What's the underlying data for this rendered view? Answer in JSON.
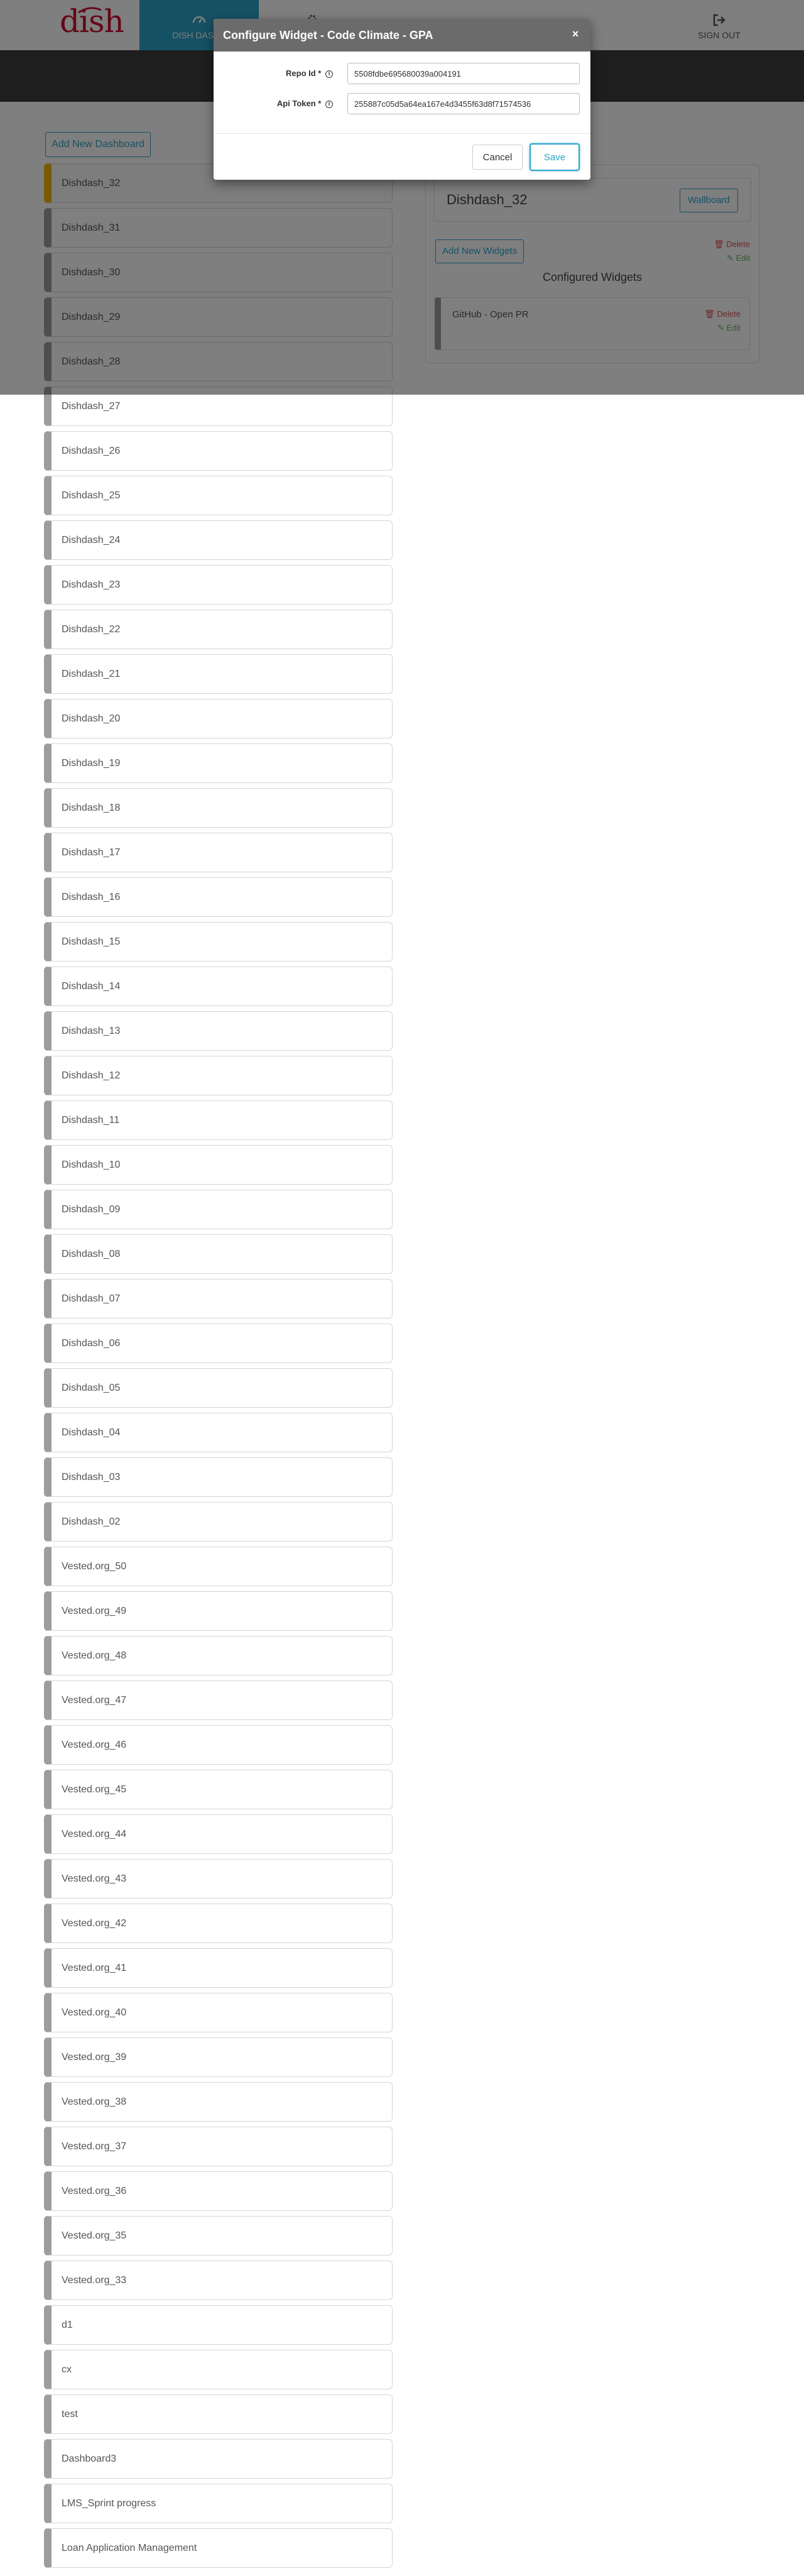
{
  "nav": {
    "logo_text": "dish",
    "dash_label": "DISH DASHB",
    "signout_label": "SIGN OUT"
  },
  "dashboards": {
    "add_label": "Add New Dashboard",
    "active_index": 0,
    "items": [
      "Dishdash_32",
      "Dishdash_31",
      "Dishdash_30",
      "Dishdash_29",
      "Dishdash_28",
      "Dishdash_27",
      "Dishdash_26",
      "Dishdash_25",
      "Dishdash_24",
      "Dishdash_23",
      "Dishdash_22",
      "Dishdash_21",
      "Dishdash_20",
      "Dishdash_19",
      "Dishdash_18",
      "Dishdash_17",
      "Dishdash_16",
      "Dishdash_15",
      "Dishdash_14",
      "Dishdash_13",
      "Dishdash_12",
      "Dishdash_11",
      "Dishdash_10",
      "Dishdash_09",
      "Dishdash_08",
      "Dishdash_07",
      "Dishdash_06",
      "Dishdash_05",
      "Dishdash_04",
      "Dishdash_03",
      "Dishdash_02",
      "Vested.org_50",
      "Vested.org_49",
      "Vested.org_48",
      "Vested.org_47",
      "Vested.org_46",
      "Vested.org_45",
      "Vested.org_44",
      "Vested.org_43",
      "Vested.org_42",
      "Vested.org_41",
      "Vested.org_40",
      "Vested.org_39",
      "Vested.org_38",
      "Vested.org_37",
      "Vested.org_36",
      "Vested.org_35",
      "Vested.org_33",
      "d1",
      "cx",
      "test",
      "Dashboard3",
      "LMS_Sprint progress",
      "Loan Application Management"
    ]
  },
  "panel": {
    "title": "Dishdash_32",
    "wallboard_label": "Wallboard",
    "add_widget_label": "Add New Widgets",
    "delete_label": "Delete",
    "edit_label": "Edit",
    "configured_title": "Configured Widgets",
    "widgets": [
      {
        "name": "GitHub - Open PR",
        "delete_label": "Delete",
        "edit_label": "Edit"
      }
    ]
  },
  "modal": {
    "title": "Configure Widget - Code Climate - GPA",
    "close_glyph": "×",
    "repo_label": "Repo Id *",
    "repo_value": "5508fdbe695680039a004191",
    "token_label": "Api Token *",
    "token_value": "255887c05d5a64ea167e4d3455f63d8f71574536",
    "cancel_label": "Cancel",
    "save_label": "Save"
  },
  "colors": {
    "accent": "#2ba3c9",
    "brand": "#c8102e",
    "active_marker": "#f0b400",
    "delete": "#d9534f",
    "edit": "#5cb85c"
  }
}
